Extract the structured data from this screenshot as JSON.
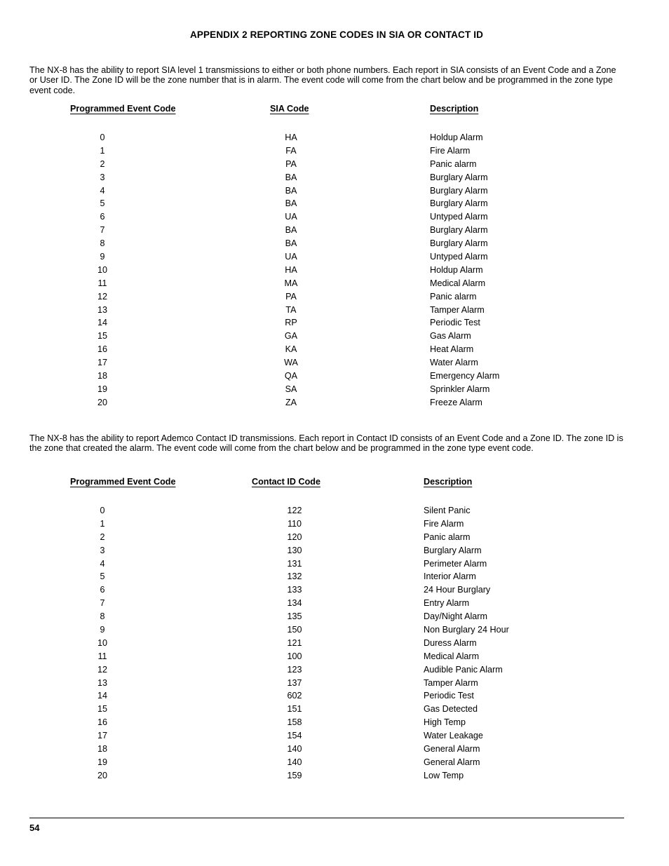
{
  "document": {
    "title": "APPENDIX 2 REPORTING ZONE CODES IN SIA OR CONTACT ID",
    "page_number": "54"
  },
  "paragraphs": {
    "sia": "The NX-8 has the ability to report SIA level 1 transmissions to either or both phone numbers. Each report in SIA consists of an Event Code and a Zone or User ID. The Zone ID will be the zone number that is in alarm. The event code will come from the chart below and be programmed in the zone type event code.",
    "contact_id": "The NX-8 has the ability to report Ademco Contact ID transmissions. Each report in Contact ID consists of an Event Code and a Zone ID. The zone ID is the zone that created the alarm. The event code will come from the chart below and be programmed in the zone type event code."
  },
  "sia_table": {
    "headers": {
      "event_code": "Programmed Event Code",
      "code": "SIA Code",
      "description": "Description"
    },
    "rows": [
      {
        "event_code": "0",
        "code": "HA",
        "description": "Holdup Alarm"
      },
      {
        "event_code": "1",
        "code": "FA",
        "description": "Fire Alarm"
      },
      {
        "event_code": "2",
        "code": "PA",
        "description": "Panic alarm"
      },
      {
        "event_code": "3",
        "code": "BA",
        "description": "Burglary Alarm"
      },
      {
        "event_code": "4",
        "code": "BA",
        "description": "Burglary Alarm"
      },
      {
        "event_code": "5",
        "code": "BA",
        "description": "Burglary Alarm"
      },
      {
        "event_code": "6",
        "code": "UA",
        "description": "Untyped Alarm"
      },
      {
        "event_code": "7",
        "code": "BA",
        "description": "Burglary Alarm"
      },
      {
        "event_code": "8",
        "code": "BA",
        "description": "Burglary Alarm"
      },
      {
        "event_code": "9",
        "code": "UA",
        "description": "Untyped Alarm"
      },
      {
        "event_code": "10",
        "code": "HA",
        "description": "Holdup Alarm"
      },
      {
        "event_code": "11",
        "code": "MA",
        "description": "Medical Alarm"
      },
      {
        "event_code": "12",
        "code": "PA",
        "description": "Panic alarm"
      },
      {
        "event_code": "13",
        "code": "TA",
        "description": "Tamper Alarm"
      },
      {
        "event_code": "14",
        "code": "RP",
        "description": "Periodic Test"
      },
      {
        "event_code": "15",
        "code": "GA",
        "description": "Gas Alarm"
      },
      {
        "event_code": "16",
        "code": "KA",
        "description": "Heat Alarm"
      },
      {
        "event_code": "17",
        "code": "WA",
        "description": "Water Alarm"
      },
      {
        "event_code": "18",
        "code": "QA",
        "description": "Emergency Alarm"
      },
      {
        "event_code": "19",
        "code": "SA",
        "description": "Sprinkler Alarm"
      },
      {
        "event_code": "20",
        "code": "ZA",
        "description": "Freeze Alarm"
      }
    ]
  },
  "contact_id_table": {
    "headers": {
      "event_code": "Programmed Event Code",
      "code": "Contact ID Code",
      "description": "Description"
    },
    "rows": [
      {
        "event_code": "0",
        "code": "122",
        "description": "Silent Panic"
      },
      {
        "event_code": "1",
        "code": "110",
        "description": "Fire Alarm"
      },
      {
        "event_code": "2",
        "code": "120",
        "description": "Panic alarm"
      },
      {
        "event_code": "3",
        "code": "130",
        "description": "Burglary Alarm"
      },
      {
        "event_code": "4",
        "code": "131",
        "description": "Perimeter Alarm"
      },
      {
        "event_code": "5",
        "code": "132",
        "description": "Interior Alarm"
      },
      {
        "event_code": "6",
        "code": "133",
        "description": "24 Hour Burglary"
      },
      {
        "event_code": "7",
        "code": "134",
        "description": "Entry Alarm"
      },
      {
        "event_code": "8",
        "code": "135",
        "description": "Day/Night Alarm"
      },
      {
        "event_code": "9",
        "code": "150",
        "description": "Non Burglary 24 Hour"
      },
      {
        "event_code": "10",
        "code": "121",
        "description": "Duress Alarm"
      },
      {
        "event_code": "11",
        "code": "100",
        "description": "Medical Alarm"
      },
      {
        "event_code": "12",
        "code": "123",
        "description": "Audible Panic Alarm"
      },
      {
        "event_code": "13",
        "code": "137",
        "description": "Tamper Alarm"
      },
      {
        "event_code": "14",
        "code": "602",
        "description": "Periodic Test"
      },
      {
        "event_code": "15",
        "code": "151",
        "description": "Gas Detected"
      },
      {
        "event_code": "16",
        "code": "158",
        "description": "High Temp"
      },
      {
        "event_code": "17",
        "code": "154",
        "description": "Water Leakage"
      },
      {
        "event_code": "18",
        "code": "140",
        "description": "General Alarm"
      },
      {
        "event_code": "19",
        "code": "140",
        "description": "General Alarm"
      },
      {
        "event_code": "20",
        "code": "159",
        "description": "Low Temp"
      }
    ]
  }
}
